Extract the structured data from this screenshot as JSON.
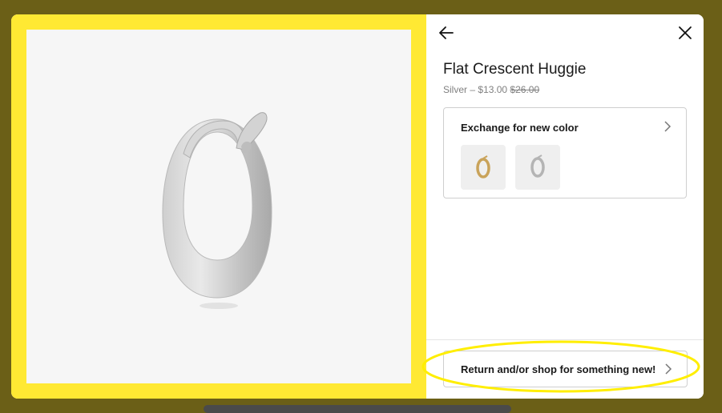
{
  "product": {
    "title": "Flat Crescent Huggie",
    "variant": "Silver",
    "separator": "–",
    "price": "$13.00",
    "original_price": "$26.00"
  },
  "exchange": {
    "label": "Exchange for new color",
    "swatches": [
      {
        "name": "Gold",
        "icon": "gold-hoop-icon"
      },
      {
        "name": "Silver",
        "icon": "silver-hoop-icon"
      }
    ]
  },
  "return_option": {
    "label": "Return and/or shop for something new!"
  },
  "colors": {
    "backdrop": "#6b5f17",
    "image_frame": "#ffe933",
    "highlight": "#ffee00"
  }
}
